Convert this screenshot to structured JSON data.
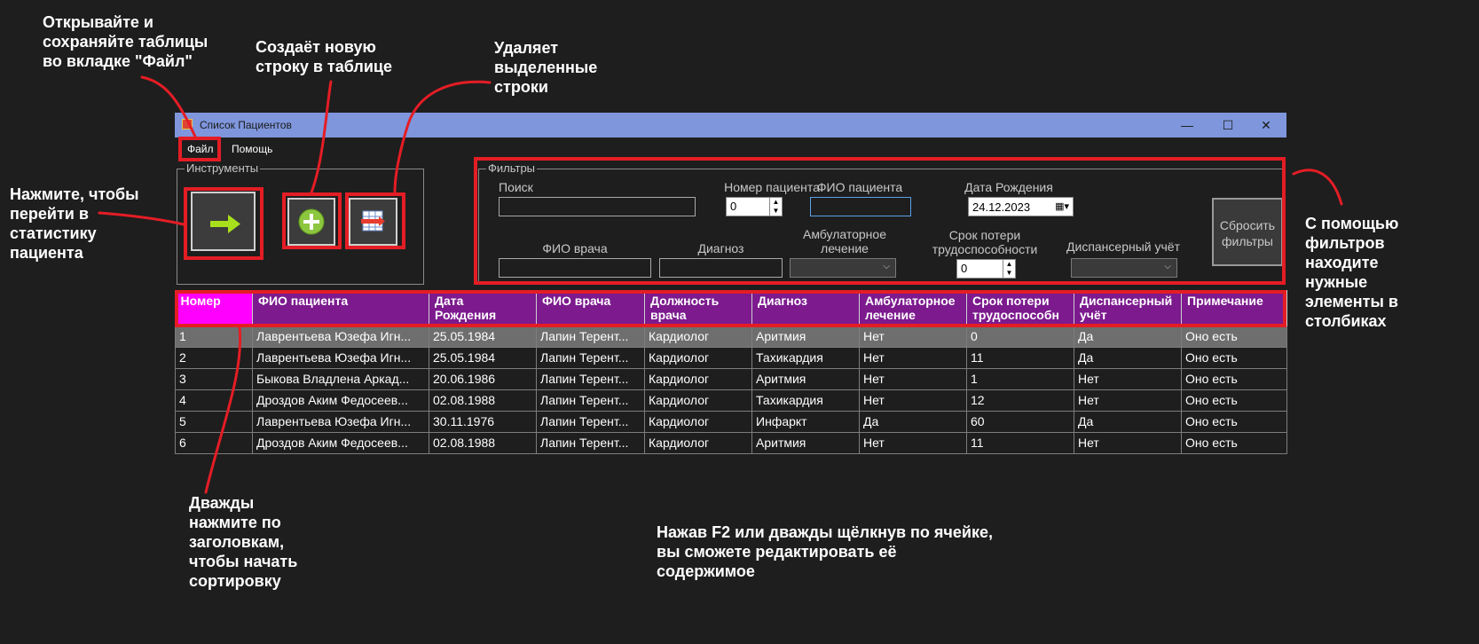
{
  "window": {
    "title": "Список Пациентов",
    "controls": {
      "minimize": "—",
      "maximize": "☐",
      "close": "✕"
    }
  },
  "menu": {
    "file": "Файл",
    "help": "Помощь"
  },
  "tools": {
    "legend": "Инструменты",
    "stats_icon": "arrow-right-icon",
    "add_icon": "plus-circle-icon",
    "delete_icon": "delete-rows-icon"
  },
  "filters": {
    "legend": "Фильтры",
    "search_label": "Поиск",
    "search_value": "",
    "patient_number_label": "Номер пациента",
    "patient_number_value": "0",
    "patient_name_label": "ФИО пациента",
    "patient_name_value": "",
    "birth_date_label": "Дата Рождения",
    "birth_date_value": "24.12.2023",
    "doctor_name_label": "ФИО врача",
    "doctor_name_value": "",
    "diagnosis_label": "Диагноз",
    "diagnosis_value": "",
    "outpatient_label_1": "Амбулаторное",
    "outpatient_label_2": "лечение",
    "disability_label_1": "Срок потери",
    "disability_label_2": "трудоспособности",
    "disability_value": "0",
    "dispensary_label": "Диспансерный учёт",
    "reset_button_1": "Сбросить",
    "reset_button_2": "фильтры"
  },
  "table": {
    "columns": [
      [
        "Номер",
        ""
      ],
      [
        "ФИО пациента",
        ""
      ],
      [
        "Дата",
        "Рождения"
      ],
      [
        "ФИО врача",
        ""
      ],
      [
        "Должность",
        "врача"
      ],
      [
        "Диагноз",
        ""
      ],
      [
        "Амбулаторное",
        "лечение"
      ],
      [
        "Срок потери",
        "трудоспособн"
      ],
      [
        "Диспансерный",
        "учёт"
      ],
      [
        "Примечание",
        ""
      ]
    ],
    "rows": [
      [
        "1",
        "Лаврентьева Юзефа Игн...",
        "25.05.1984",
        "Лапин Терент...",
        "Кардиолог",
        "Аритмия",
        "Нет",
        "0",
        "Да",
        "Оно есть"
      ],
      [
        "2",
        "Лаврентьева Юзефа Игн...",
        "25.05.1984",
        "Лапин Терент...",
        "Кардиолог",
        "Тахикардия",
        "Нет",
        "11",
        "Да",
        "Оно есть"
      ],
      [
        "3",
        "Быкова Владлена Аркад...",
        "20.06.1986",
        "Лапин Терент...",
        "Кардиолог",
        "Аритмия",
        "Нет",
        "1",
        "Нет",
        "Оно есть"
      ],
      [
        "4",
        "Дроздов Аким Федосеев...",
        "02.08.1988",
        "Лапин Терент...",
        "Кардиолог",
        "Тахикардия",
        "Нет",
        "12",
        "Нет",
        "Оно есть"
      ],
      [
        "5",
        "Лаврентьева Юзефа Игн...",
        "30.11.1976",
        "Лапин Терент...",
        "Кардиолог",
        "Инфаркт",
        "Да",
        "60",
        "Да",
        "Оно есть"
      ],
      [
        "6",
        "Дроздов Аким Федосеев...",
        "02.08.1988",
        "Лапин Терент...",
        "Кардиолог",
        "Аритмия",
        "Нет",
        "11",
        "Нет",
        "Оно есть"
      ]
    ],
    "selected_row": 0
  },
  "annotations": {
    "file_tab": [
      "Открывайте и",
      "сохраняйте таблицы",
      "во вкладке \"Файл\""
    ],
    "add_row": [
      "Создаёт новую",
      "строку в таблице"
    ],
    "delete_rows": [
      "Удаляет",
      "выделенные",
      "строки"
    ],
    "stats": [
      "Нажмите, чтобы",
      "перейти в",
      "статистику",
      "пациента"
    ],
    "filters": [
      "С помощью",
      "фильтров",
      "находите",
      "нужные",
      "элементы в",
      "столбиках"
    ],
    "sorting": [
      "Дважды",
      "нажмите по",
      "заголовкам,",
      "чтобы начать",
      "сортировку"
    ],
    "edit_cell": [
      "Нажав F2 или дважды щёлкнув по ячейке,",
      "вы сможете редактировать её",
      "содержимое"
    ]
  },
  "colors": {
    "background": "#1e1e1e",
    "titlebar": "#7f96dc",
    "header": "#7c1a8e",
    "header_first": "#ff00ff",
    "highlight": "#e41d25",
    "selected_row": "#6e6e6e"
  }
}
